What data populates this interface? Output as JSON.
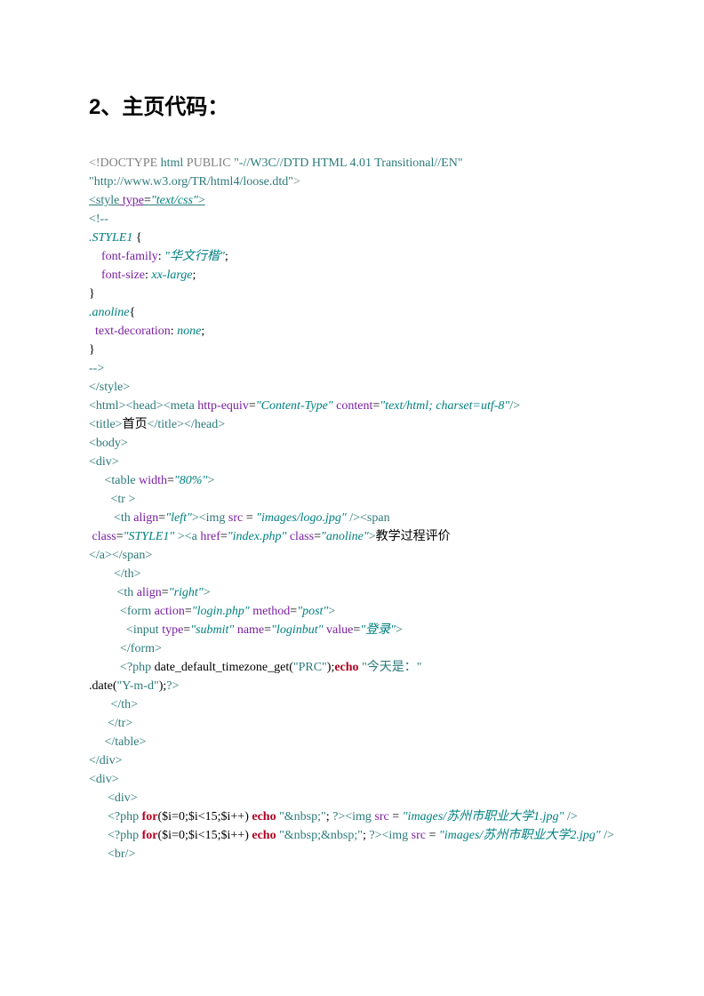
{
  "heading": "2、主页代码：",
  "code": {
    "l1": {
      "a": "<!DOCTYPE ",
      "b": "html",
      "c": " PUBLIC ",
      "d": "\"-//W3C//DTD HTML 4.01 Transitional//EN\""
    },
    "l2": {
      "a": "\"http://www.w3.org/TR/html4/loose.dtd\"",
      "b": ">"
    },
    "l3": {
      "a": "<style",
      "sp": " ",
      "b": "type",
      "c": "=",
      "d": "\"text/css\"",
      "e": ">"
    },
    "l4": {
      "a": "<!--"
    },
    "l5": {
      "a": ".STYLE1",
      "b": " {"
    },
    "l6": {
      "a": "    font-family",
      "b": ": ",
      "c": "\"华文行楷\"",
      "d": ";"
    },
    "l7": {
      "a": "    font-size",
      "b": ": ",
      "c": "xx-large",
      "d": ";"
    },
    "l8": {
      "a": "}"
    },
    "l9": {
      "a": ".anoline",
      "b": "{"
    },
    "l10": {
      "a": "  text-decoration",
      "b": ": ",
      "c": "none",
      "d": ";"
    },
    "l11": {
      "a": "}"
    },
    "l12": {
      "a": "-->"
    },
    "l13": {
      "a": "</style>"
    },
    "l14": {
      "a": "<html><head><meta",
      "b": " http-equiv",
      "c": "=",
      "d": "\"Content-Type\"",
      "e": " content",
      "f": "=",
      "g": "\"text/html; charset=utf-8\"",
      "h": "/>"
    },
    "l15": {
      "a": "<title>",
      "b": "首页",
      "c": "</title></head>"
    },
    "l16": {
      "a": "<body>"
    },
    "l17": {
      "a": "<div>"
    },
    "l18": {
      "a": "     <table",
      "b": " width",
      "c": "=",
      "d": "\"80%\"",
      "e": ">"
    },
    "l19": {
      "a": "       <tr",
      "b": " >"
    },
    "l20": {
      "a": "        <th",
      "b": " align",
      "c": "=",
      "d": "\"left\"",
      "e": "><img",
      "f": " src",
      "g": " = ",
      "h": "\"images/logo.jpg\"",
      "i": " /><span"
    },
    "l21": {
      "a": " class",
      "b": "=",
      "c": "\"STYLE1\"",
      "d": " ><a",
      "e": " href",
      "f": "=",
      "g": "\"index.php\"",
      "h": " class",
      "i": "=",
      "j": "\"anoline\"",
      "k": ">",
      "l": "教学过程评价",
      "m": "</a></span>"
    },
    "l22": {
      "a": "        </th>"
    },
    "l23": {
      "a": "         <th",
      "b": " align",
      "c": "=",
      "d": "\"right\"",
      "e": ">"
    },
    "l24": {
      "a": "          <form",
      "b": " action",
      "c": "=",
      "d": "\"login.php\"",
      "e": " method",
      "f": "=",
      "g": "\"post\"",
      "h": ">"
    },
    "l25": {
      "a": "            <input",
      "b": " type",
      "c": "=",
      "d": "\"submit\"",
      "e": " name",
      "f": "=",
      "g": "\"loginbut\"",
      "h": " value",
      "i": "=",
      "j": "\"登录\"",
      "k": ">"
    },
    "l26": {
      "a": "          </form>"
    },
    "l27": {
      "a": "          <?php",
      "b": " date_default_timezone_get(",
      "c": "\"PRC\"",
      "d": ");",
      "e": "echo",
      "f": " ",
      "g": "\"今天是：\"",
      "h": ".date(",
      "i": "\"Y-m-d\"",
      "j": ");",
      "k": "?>"
    },
    "l28": {
      "a": "       </th>"
    },
    "l29": {
      "a": "      </tr>"
    },
    "l30": {
      "a": "     </table>"
    },
    "l31": {
      "a": "</div>"
    },
    "l32": {
      "a": "<div>"
    },
    "l33": {
      "a": "      <div>"
    },
    "l34": {
      "a": "      <?php",
      "b": " ",
      "c": "for",
      "d": "($i=0;$i<15;$i++) ",
      "e": "echo",
      "f": " ",
      "g": "\"&nbsp;\"",
      "h": "; ",
      "i": "?>",
      "j": "<img",
      "k": " src",
      "l": " = ",
      "m": "\"images/苏州市职业大学1.jpg\"",
      "n": " />"
    },
    "l35": {
      "a": "      <?php",
      "b": " ",
      "c": "for",
      "d": "($i=0;$i<15;$i++) ",
      "e": "echo",
      "f": " ",
      "g": "\"&nbsp;&nbsp;\"",
      "h": "; ",
      "i": "?>",
      "j": "<img",
      "k": " src",
      "l": " = ",
      "m": "\"images/苏州市职业大学2.jpg\"",
      "n": " />"
    },
    "l36": {
      "a": "      <br/>"
    }
  }
}
